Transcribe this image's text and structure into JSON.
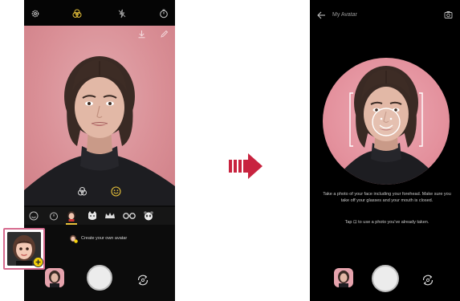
{
  "left_screen": {
    "create_avatar_text": "Create your own avatar"
  },
  "right_screen": {
    "title": "My Avatar",
    "instruction_1": "Take a photo of your face including your forehead. Make sure you take off your glasses and your mouth is closed.",
    "instruction_2": "Tap ⊡ to use a photo you've already taken."
  },
  "colors": {
    "accent_yellow": "#e8c23a",
    "preview_pink": "#d98e95",
    "avatar_frame": "#d66a8e"
  }
}
